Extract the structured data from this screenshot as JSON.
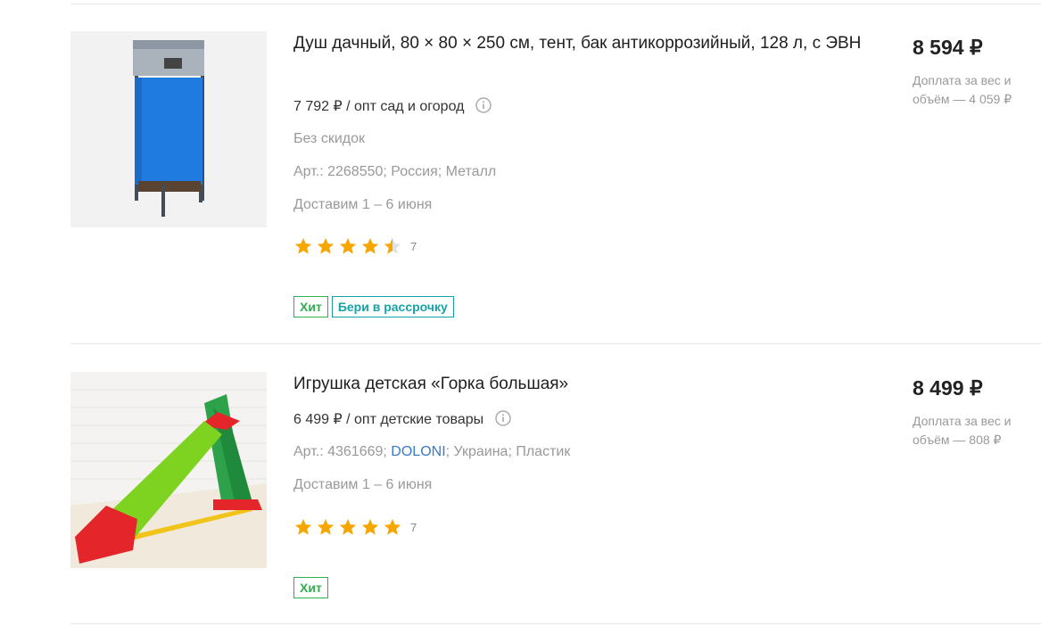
{
  "products": [
    {
      "title": "Душ дачный, 80 × 80 × 250 см, тент, бак антикоррозийный, 128 л, с ЭВН",
      "opt_price": "7 792 ₽ / опт сад и огород",
      "discount": "Без скидок",
      "art_text": "Арт.: 2268550; Россия; Металл",
      "delivery": "Доставим 1 – 6 июня",
      "rating": 4.5,
      "reviews": "7",
      "badges": [
        "Хит",
        "Бери в рассрочку"
      ],
      "price": "8 594 ₽",
      "surcharge": "Доплата за вес и объём — 4 059 ₽",
      "image_icon": "outdoor-shower-image"
    },
    {
      "title": "Игрушка детская «Горка большая»",
      "opt_price": "6 499 ₽ / опт детские товары",
      "art_prefix": "Арт.: 4361669; ",
      "brand": "DOLONI",
      "art_suffix": "; Украина; Пластик",
      "delivery": "Доставим 1 – 6 июня",
      "rating": 5,
      "reviews": "7",
      "badges": [
        "Хит"
      ],
      "price": "8 499 ₽",
      "surcharge": "Доплата за вес и объём — 808 ₽",
      "image_icon": "kids-slide-image"
    }
  ],
  "colors": {
    "star": "#f7a600",
    "hit": "#2fae4e",
    "installment": "#17a2a8",
    "brand_link": "#3a7bc8"
  }
}
